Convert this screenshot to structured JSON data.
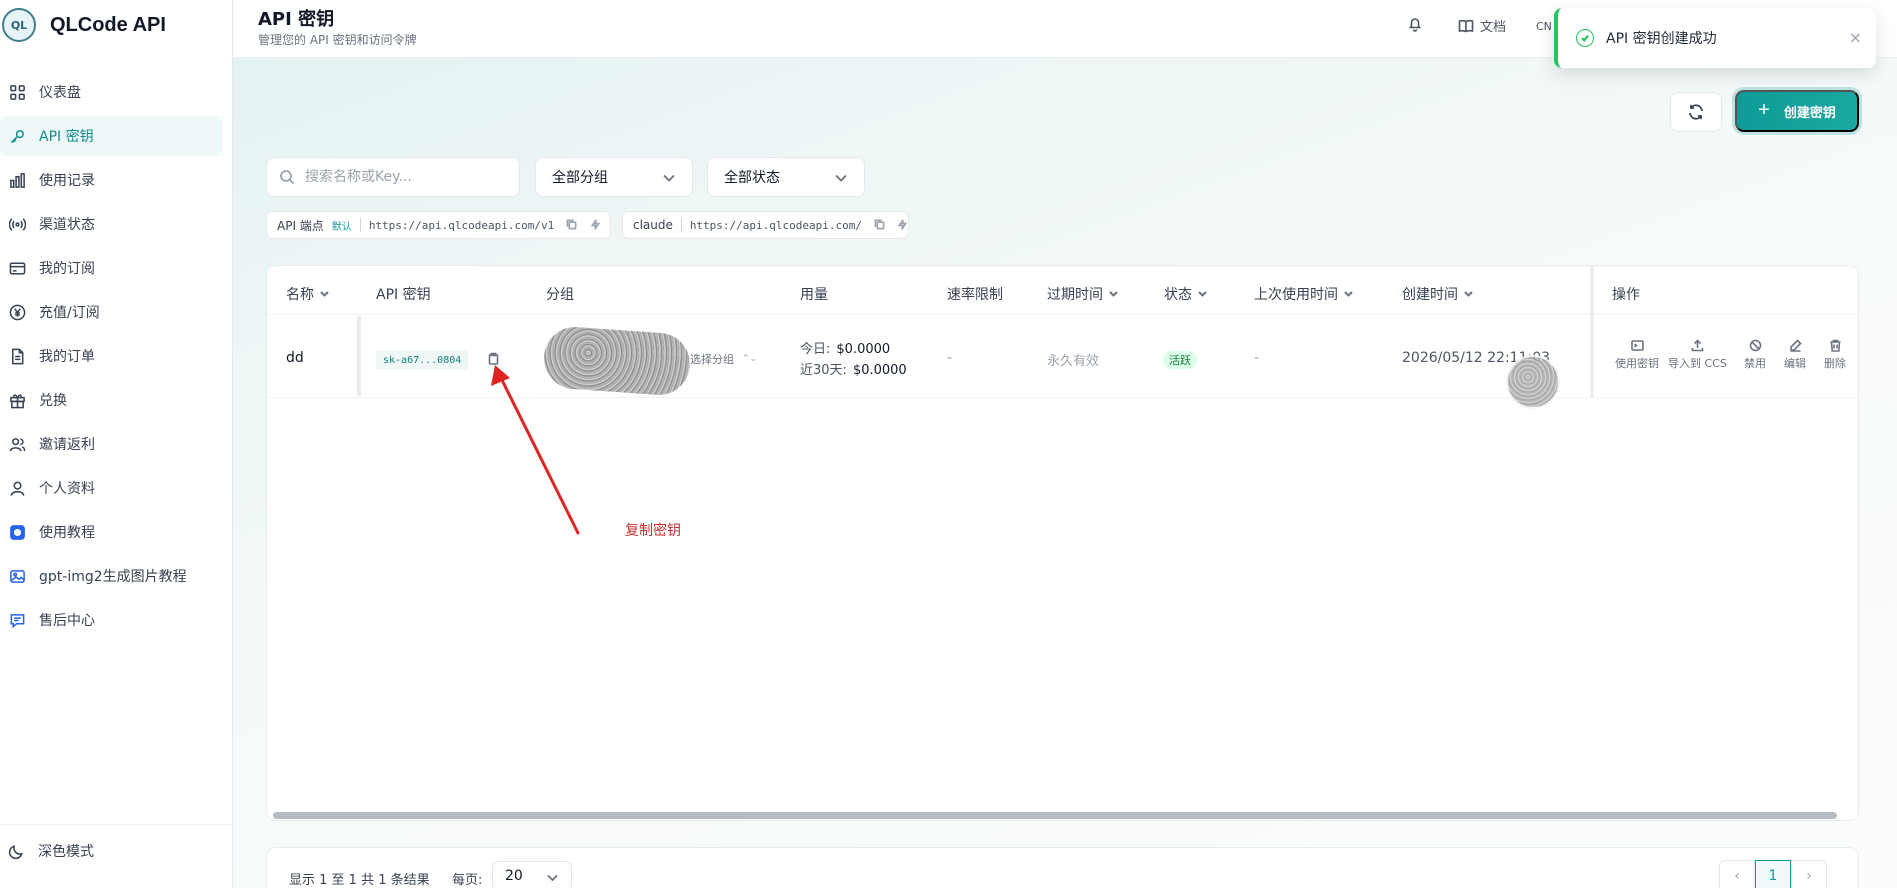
{
  "brand": {
    "name": "QLCode API",
    "logo_text": "QL"
  },
  "nav": [
    {
      "label": "仪表盘",
      "icon": "grid-icon"
    },
    {
      "label": "API 密钥",
      "icon": "key-icon",
      "active": true
    },
    {
      "label": "使用记录",
      "icon": "bar-chart-icon"
    },
    {
      "label": "渠道状态",
      "icon": "broadcast-icon"
    },
    {
      "label": "我的订阅",
      "icon": "card-icon"
    },
    {
      "label": "充值/订阅",
      "icon": "yen-icon"
    },
    {
      "label": "我的订单",
      "icon": "document-icon"
    },
    {
      "label": "兑换",
      "icon": "gift-icon"
    },
    {
      "label": "邀请返利",
      "icon": "users-icon"
    },
    {
      "label": "个人资料",
      "icon": "user-icon"
    },
    {
      "label": "使用教程",
      "icon": "tutorial-icon"
    },
    {
      "label": "gpt-img2生成图片教程",
      "icon": "image-icon"
    },
    {
      "label": "售后中心",
      "icon": "chat-icon"
    }
  ],
  "dark_mode_label": "深色模式",
  "header": {
    "title": "API 密钥",
    "subtitle": "管理您的 API 密钥和访问令牌",
    "docs_label": "文档",
    "lang": "CN"
  },
  "toast": {
    "message": "API 密钥创建成功",
    "close": "×"
  },
  "actions": {
    "create_label": "创建密钥"
  },
  "filters": {
    "search_placeholder": "搜索名称或Key...",
    "group_select": "全部分组",
    "status_select": "全部状态"
  },
  "endpoints": [
    {
      "label": "API 端点",
      "tag": "默认",
      "url": "https://api.qlcodeapi.com/v1"
    },
    {
      "label": "claude",
      "tag": "",
      "url": "https://api.qlcodeapi.com/"
    }
  ],
  "table": {
    "headers": {
      "name": "名称",
      "key": "API 密钥",
      "group": "分组",
      "usage": "用量",
      "rate": "速率限制",
      "expires": "过期时间",
      "status": "状态",
      "last_used": "上次使用时间",
      "created": "创建时间",
      "ops": "操作"
    },
    "rows": [
      {
        "name": "dd",
        "key": "sk-a67...0804",
        "group_select": "选择分组",
        "usage_today_label": "今日:",
        "usage_today": "$0.0000",
        "usage_30d_label": "近30天:",
        "usage_30d": "$0.0000",
        "rate": "-",
        "expires": "永久有效",
        "status": "活跃",
        "last_used": "-",
        "created": "2026/05/12 22:11:03"
      }
    ],
    "ops": [
      "使用密钥",
      "导入到 CCS",
      "禁用",
      "编辑",
      "删除"
    ]
  },
  "annotation": {
    "text": "复制密钥",
    "color": "#c53030"
  },
  "pagination": {
    "summary": "显示 1 至 1 共 1 条结果",
    "per_page_label": "每页:",
    "per_page": "20",
    "current_page": "1",
    "prev": "‹",
    "next": "›"
  },
  "colors": {
    "accent": "#0f9b97",
    "success": "#22c55e",
    "annotation": "#c53030"
  }
}
